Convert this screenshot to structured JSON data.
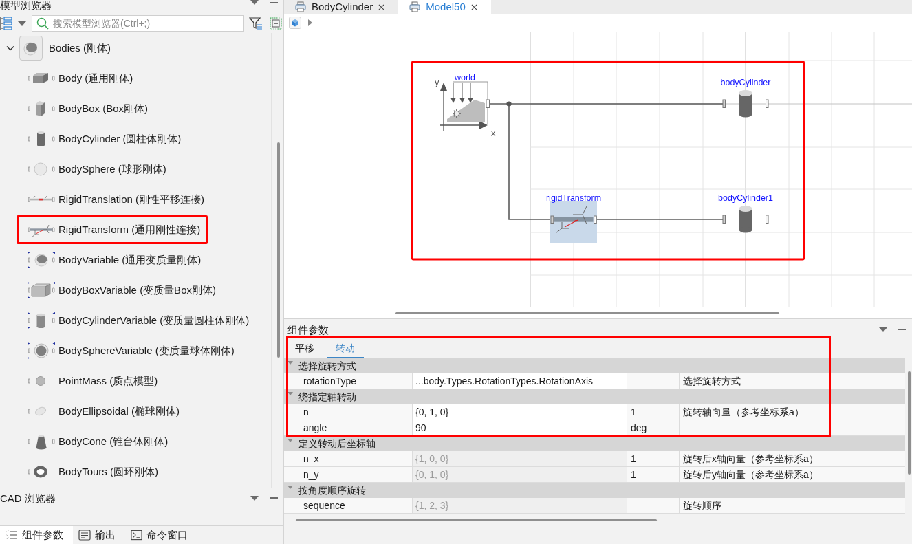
{
  "model_browser": {
    "title": "模型浏览器",
    "search": {
      "placeholder": "搜索模型浏览器(Ctrl+;)"
    },
    "tree": [
      {
        "label": "Bodies (刚体)",
        "expanded": true,
        "children": [
          {
            "label": "Body (通用刚体)",
            "kind": "body",
            "highlighted": false
          },
          {
            "label": "BodyBox (Box刚体)",
            "kind": "box",
            "highlighted": false
          },
          {
            "label": "BodyCylinder (圆柱体刚体)",
            "kind": "cylinder",
            "highlighted": false
          },
          {
            "label": "BodySphere (球形刚体)",
            "kind": "sphere",
            "highlighted": false
          },
          {
            "label": "RigidTranslation (刚性平移连接)",
            "kind": "translation",
            "highlighted": false
          },
          {
            "label": "RigidTransform (通用刚性连接)",
            "kind": "transform",
            "highlighted": true
          },
          {
            "label": "BodyVariable (通用变质量刚体)",
            "kind": "body_variable",
            "highlighted": false
          },
          {
            "label": "BodyBoxVariable (变质量Box刚体)",
            "kind": "box_variable",
            "highlighted": false
          },
          {
            "label": "BodyCylinderVariable (变质量圆柱体刚体)",
            "kind": "cylinder_variable",
            "highlighted": false
          },
          {
            "label": "BodySphereVariable (变质量球体刚体)",
            "kind": "sphere_variable",
            "highlighted": false
          },
          {
            "label": "PointMass (质点模型)",
            "kind": "point_mass",
            "highlighted": false
          },
          {
            "label": "BodyEllipsoidal (椭球刚体)",
            "kind": "ellipsoid",
            "highlighted": false
          },
          {
            "label": "BodyCone (锥台体刚体)",
            "kind": "cone",
            "highlighted": false
          },
          {
            "label": "BodyTours (圆环刚体)",
            "kind": "torus",
            "highlighted": false
          }
        ]
      }
    ]
  },
  "cad_browser": {
    "title": "CAD 浏览器"
  },
  "bottom_tabs": [
    {
      "label": "组件参数",
      "kind": "parameters",
      "selected": true
    },
    {
      "label": "输出",
      "kind": "output",
      "selected": false
    },
    {
      "label": "命令窗口",
      "kind": "console",
      "selected": false
    }
  ],
  "editor_tabs": [
    {
      "label": "BodyCylinder",
      "selected": false
    },
    {
      "label": "Model50",
      "selected": true
    }
  ],
  "diagram": {
    "highlighted": true,
    "nodes": [
      {
        "label": "world",
        "kind": "world",
        "selected": false,
        "y_axis_label": "y",
        "x_axis_label": "x"
      },
      {
        "label": "bodyCylinder",
        "kind": "cylinder",
        "selected": false
      },
      {
        "label": "rigidTransform",
        "kind": "transform",
        "selected": true
      },
      {
        "label": "bodyCylinder1",
        "kind": "cylinder",
        "selected": false
      }
    ]
  },
  "parameters": {
    "title": "组件参数",
    "tabs": [
      {
        "label": "平移",
        "selected": false
      },
      {
        "label": "转动",
        "selected": true
      }
    ],
    "groups": [
      {
        "title": "选择旋转方式",
        "expanded": true,
        "highlighted": true,
        "rows": [
          {
            "name": "rotationType",
            "value": "...body.Types.RotationTypes.RotationAxis",
            "inherited": false,
            "description": "选择旋转方式"
          }
        ]
      },
      {
        "title": "绕指定轴转动",
        "expanded": true,
        "highlighted": true,
        "rows": [
          {
            "name": "n",
            "value": "{0, 1, 0}",
            "inherited": false,
            "unit": "1",
            "description": "旋转轴向量（参考坐标系a）"
          },
          {
            "name": "angle",
            "value": "90",
            "inherited": false,
            "unit": "deg"
          }
        ]
      },
      {
        "title": "定义转动后坐标轴",
        "expanded": true,
        "highlighted": false,
        "rows": [
          {
            "name": "n_x",
            "value": "{1, 0, 0}",
            "inherited": true,
            "unit": "1",
            "description": "旋转后x轴向量（参考坐标系a）"
          },
          {
            "name": "n_y",
            "value": "{0, 1, 0}",
            "inherited": true,
            "unit": "1",
            "description": "旋转后y轴向量（参考坐标系a）"
          }
        ]
      },
      {
        "title": "按角度顺序旋转",
        "expanded": true,
        "highlighted": false,
        "rows": [
          {
            "name": "sequence",
            "value": "{1, 2, 3}",
            "inherited": true,
            "description": "旋转顺序"
          }
        ]
      }
    ]
  }
}
